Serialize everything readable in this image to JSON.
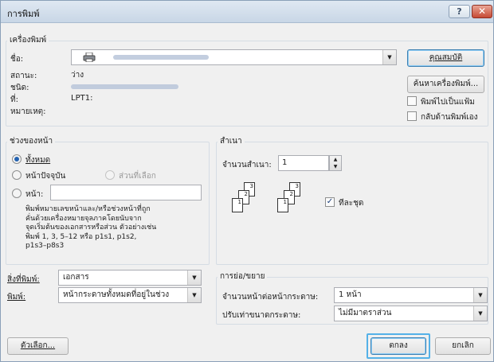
{
  "window": {
    "title": "การพิมพ์",
    "help": "?",
    "close": "✕"
  },
  "printer": {
    "group_label": "เครื่องพิมพ์",
    "name_label": "ชื่อ:",
    "status_label": "สถานะ:",
    "status_value": "ว่าง",
    "type_label": "ชนิด:",
    "where_label": "ที่:",
    "where_value": "LPT1:",
    "comment_label": "หมายเหตุ:",
    "properties_button": "คุณสมบัติ",
    "find_button": "ค้นหาเครื่องพิมพ์...",
    "print_to_file": "พิมพ์ไปเป็นแฟ้ม",
    "manual_duplex": "กลับด้านพิมพ์เอง",
    "print_to_file_checked": false,
    "manual_duplex_checked": false
  },
  "page_range": {
    "group_label": "ช่วงของหน้า",
    "all": "ทั้งหมด",
    "current": "หน้าปัจจุบัน",
    "selection": "ส่วนที่เลือก",
    "pages": "หน้า:",
    "pages_value": "",
    "selected": "all",
    "help_lines": [
      "พิมพ์หมายเลขหน้าและ/หรือช่วงหน้าที่ถูก",
      "คั่นด้วยเครื่องหมายจุลภาคโดยนับจาก",
      "จุดเริ่มต้นของเอกสารหรือส่วน ตัวอย่างเช่น",
      "พิมพ์ 1, 3, 5–12 หรือ p1s1, p1s2,",
      "p1s3–p8s3"
    ]
  },
  "copies": {
    "group_label": "สำเนา",
    "count_label": "จำนวนสำเนา:",
    "count_value": "1",
    "collate": "ทีละชุด",
    "collate_checked": true,
    "page_nums": [
      "3",
      "2",
      "1",
      "3",
      "2",
      "1"
    ]
  },
  "print_what": {
    "label": "สิ่งที่พิมพ์:",
    "value": "เอกสาร"
  },
  "print": {
    "label": "พิมพ์:",
    "value": "หน้ากระดาษทั้งหมดที่อยู่ในช่วง"
  },
  "zoom": {
    "group_label": "การย่อ/ขยาย",
    "pages_per_sheet_label": "จำนวนหน้าต่อหน้ากระดาษ:",
    "pages_per_sheet_value": "1 หน้า",
    "scale_label": "ปรับเท่าขนาดกระดาษ:",
    "scale_value": "ไม่มีมาตราส่วน"
  },
  "footer": {
    "options": "ตัวเลือก...",
    "ok": "ตกลง",
    "cancel": "ยกเลิก"
  },
  "icons": {
    "printer": "printer-icon",
    "dropdown": "chevron-down-icon",
    "spin": "spin-up-down-icon",
    "check": "✓"
  }
}
